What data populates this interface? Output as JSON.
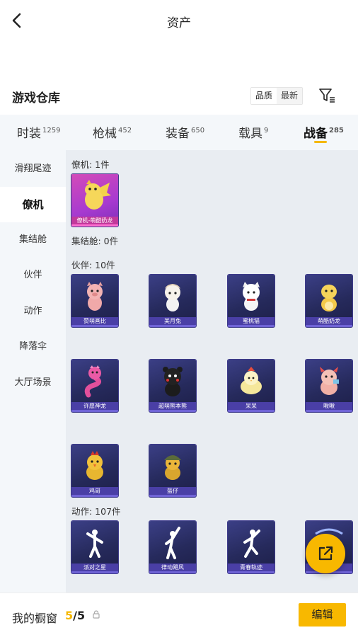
{
  "header": {
    "title": "资产"
  },
  "section": {
    "title": "游戏仓库"
  },
  "sort": {
    "options": [
      "品质",
      "最新"
    ]
  },
  "tabs": [
    {
      "label": "时装",
      "count": "1259"
    },
    {
      "label": "枪械",
      "count": "452"
    },
    {
      "label": "装备",
      "count": "650"
    },
    {
      "label": "载具",
      "count": "9"
    },
    {
      "label": "战备",
      "count": "285"
    }
  ],
  "sidebar": [
    "滑翔尾迹",
    "僚机",
    "集结舱",
    "伙伴",
    "动作",
    "降落伞",
    "大厅场景"
  ],
  "groups": {
    "wingman": {
      "label": "僚机: 1件",
      "items": [
        "僚机-萌酷奶龙"
      ]
    },
    "pod": {
      "label": "集结舱: 0件"
    },
    "partner": {
      "label": "伙伴: 10件",
      "items": [
        "赞萌画比",
        "美月兔",
        "蜜桃猫",
        "萌酷奶龙",
        "许愿神龙",
        "超萌熊本熊",
        "呆呆",
        "啾啾",
        "鸡哥",
        "盔仔"
      ]
    },
    "action": {
      "label": "动作: 107件",
      "items": [
        "派对之星",
        "律动飓风",
        "青春轨迹",
        ""
      ]
    }
  },
  "bottom": {
    "label": "我的橱窗",
    "current": "5",
    "total": "/5",
    "edit": "编辑"
  },
  "colors": {
    "accent": "#f8b800",
    "card_bg": "#262a5c",
    "card_rare": "#c2399b"
  },
  "icons": {
    "back": "chevron-left-icon",
    "filter": "filter-icon",
    "lock": "lock-icon",
    "share": "external-link-icon"
  }
}
